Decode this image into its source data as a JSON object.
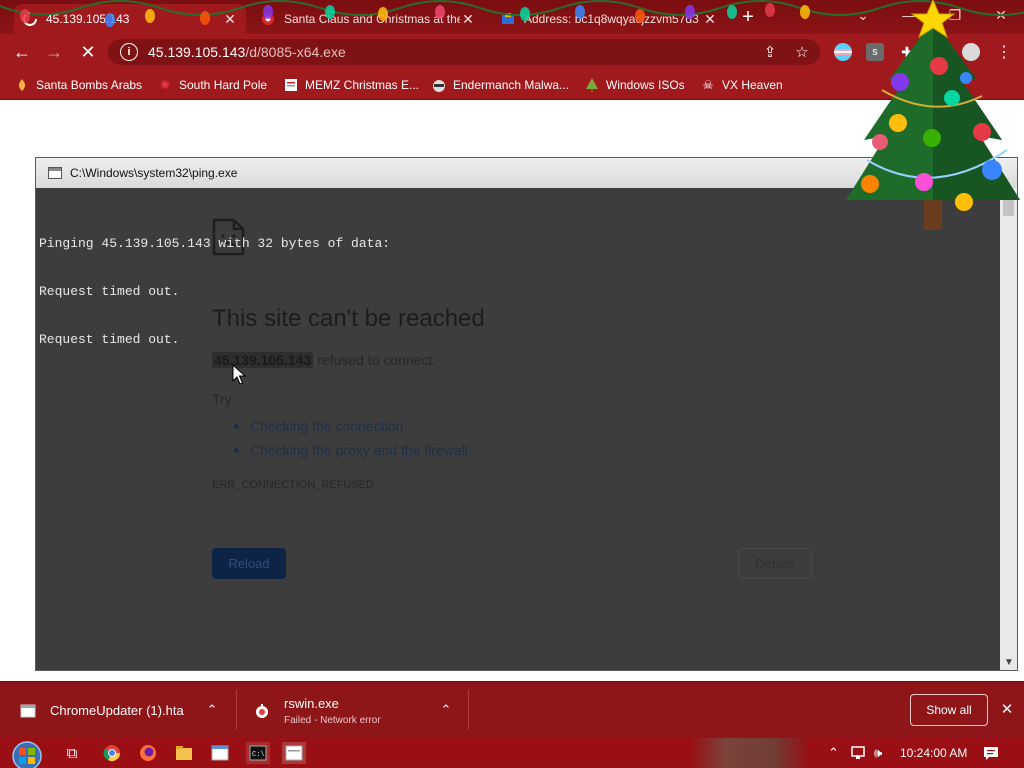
{
  "browser": {
    "tabs": [
      {
        "title": "45.139.105.143",
        "active": true
      },
      {
        "title": "Santa Claus and Christmas at the",
        "active": false
      },
      {
        "title": "Address: bc1q8wqyacjzzvm57d3",
        "active": false
      }
    ],
    "url": {
      "host": "45.139.105.143",
      "path": "/d/8085-x64.exe"
    },
    "bookmarks": [
      {
        "label": "Santa Bombs Arabs",
        "icon": "flame-icon"
      },
      {
        "label": "South Hard Pole",
        "icon": "snowflake-icon"
      },
      {
        "label": "MEMZ Christmas E...",
        "icon": "page-icon"
      },
      {
        "label": "Endermanch Malwa...",
        "icon": "raccoon-icon"
      },
      {
        "label": "Windows ISOs",
        "icon": "tree-icon"
      },
      {
        "label": "VX Heaven",
        "icon": "skull-icon"
      }
    ],
    "theme": {
      "frame": "#8c1417",
      "toolbar": "#a0191c",
      "accent": "#1a73e8"
    }
  },
  "console": {
    "title": "C:\\Windows\\system32\\ping.exe",
    "lines": [
      "Pinging 45.139.105.143 with 32 bytes of data:",
      "Request timed out.",
      "Request timed out."
    ]
  },
  "error_page": {
    "heading": "This site can't be reached",
    "host": "45.139.105.143",
    "message": "refused to connect.",
    "try_label": "Try:",
    "suggestions": [
      "Checking the connection",
      "Checking the proxy and the firewall"
    ],
    "code": "ERR_CONNECTION_REFUSED",
    "reload_label": "Reload",
    "details_label": "Details"
  },
  "downloads": {
    "items": [
      {
        "name": "ChromeUpdater (1).hta",
        "status": ""
      },
      {
        "name": "rswin.exe",
        "status": "Failed - Network error"
      }
    ],
    "show_all_label": "Show all"
  },
  "taskbar": {
    "clock": "10:24:00 AM"
  }
}
